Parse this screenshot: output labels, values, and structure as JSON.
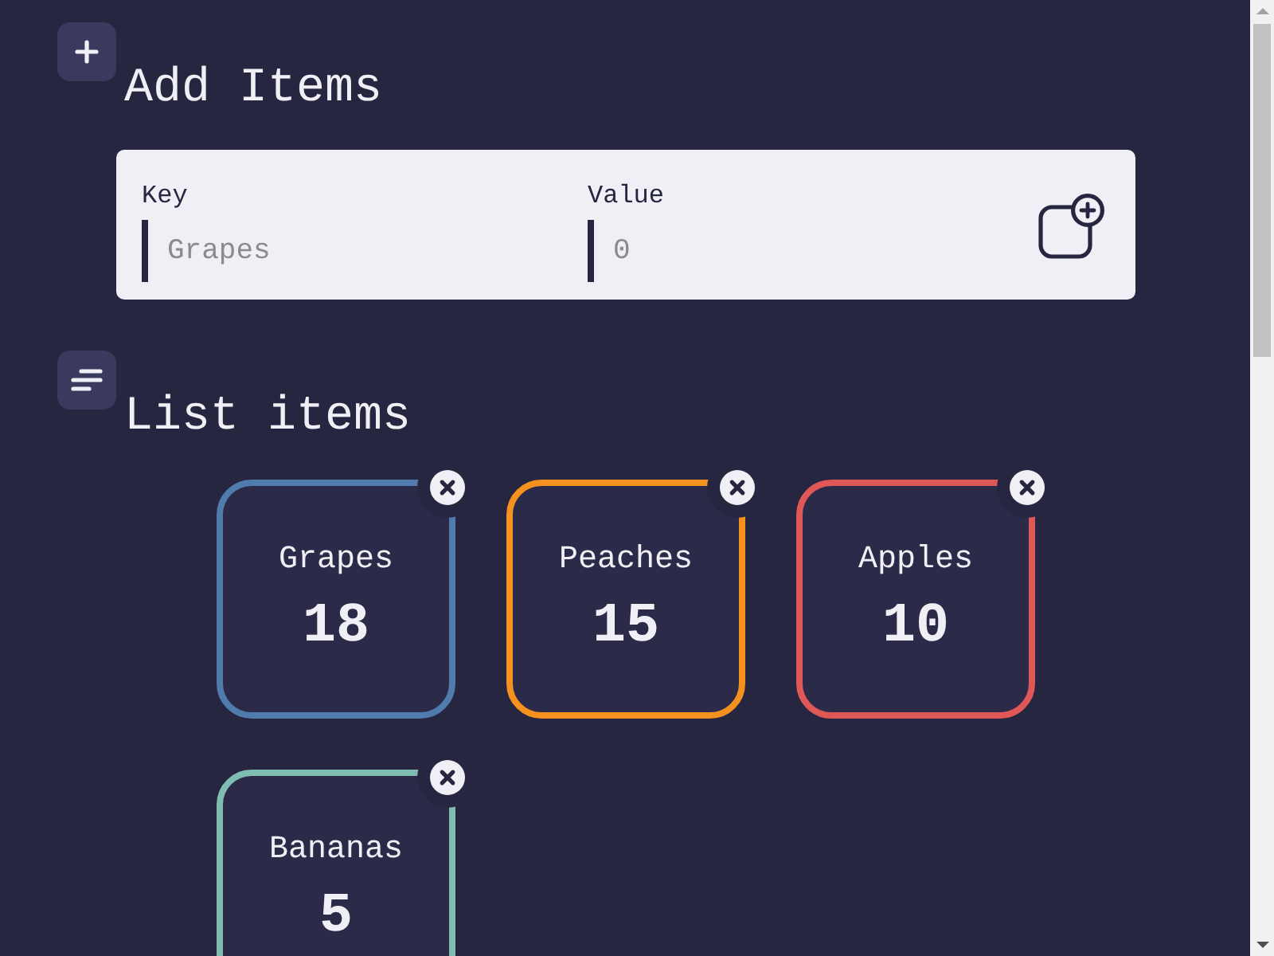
{
  "add_items": {
    "title": "Add Items",
    "fields": [
      {
        "label": "Key",
        "placeholder": "Grapes"
      },
      {
        "label": "Value",
        "placeholder": "0"
      }
    ]
  },
  "list_items": {
    "title": "List items",
    "items": [
      {
        "name": "Grapes",
        "count": "18",
        "color": "#4f7cac"
      },
      {
        "name": "Peaches",
        "count": "15",
        "color": "#f5921f"
      },
      {
        "name": "Apples",
        "count": "10",
        "color": "#e05757"
      },
      {
        "name": "Bananas",
        "count": "5",
        "color": "#7fbcb2"
      }
    ]
  }
}
